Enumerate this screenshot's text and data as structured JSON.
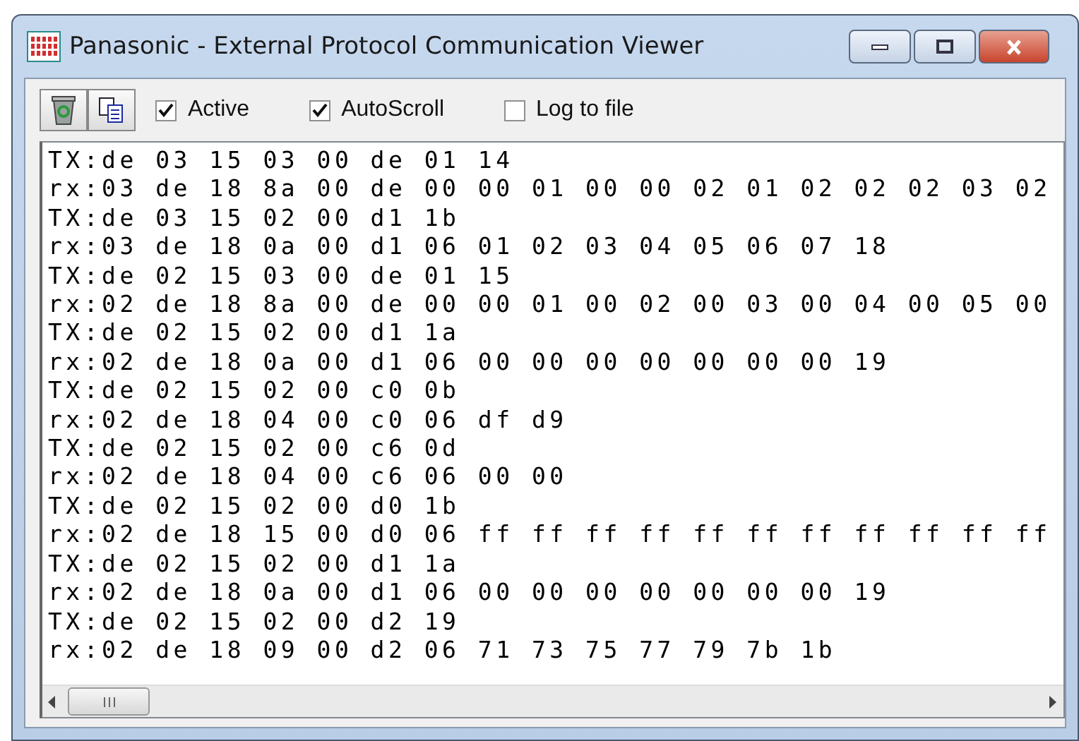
{
  "window": {
    "title": "Panasonic - External Protocol Communication Viewer"
  },
  "toolbar": {
    "checkboxes": [
      {
        "label": "Active",
        "checked": true
      },
      {
        "label": "AutoScroll",
        "checked": true
      },
      {
        "label": "Log to file",
        "checked": false
      }
    ]
  },
  "log": {
    "lines": [
      "TX:de 03 15 03 00 de 01 14",
      "rx:03 de 18 8a 00 de 00 00 01 00 00 02 01 02 02 02 03 02",
      "TX:de 03 15 02 00 d1 1b",
      "rx:03 de 18 0a 00 d1 06 01 02 03 04 05 06 07 18",
      "TX:de 02 15 03 00 de 01 15",
      "rx:02 de 18 8a 00 de 00 00 01 00 02 00 03 00 04 00 05 00",
      "TX:de 02 15 02 00 d1 1a",
      "rx:02 de 18 0a 00 d1 06 00 00 00 00 00 00 00 19",
      "TX:de 02 15 02 00 c0 0b",
      "rx:02 de 18 04 00 c0 06 df d9",
      "TX:de 02 15 02 00 c6 0d",
      "rx:02 de 18 04 00 c6 06 00 00",
      "TX:de 02 15 02 00 d0 1b",
      "rx:02 de 18 15 00 d0 06 ff ff ff ff ff ff ff ff ff ff ff",
      "TX:de 02 15 02 00 d1 1a",
      "rx:02 de 18 0a 00 d1 06 00 00 00 00 00 00 00 19",
      "TX:de 02 15 02 00 d2 19",
      "rx:02 de 18 09 00 d2 06 71 73 75 77 79 7b 1b"
    ]
  }
}
